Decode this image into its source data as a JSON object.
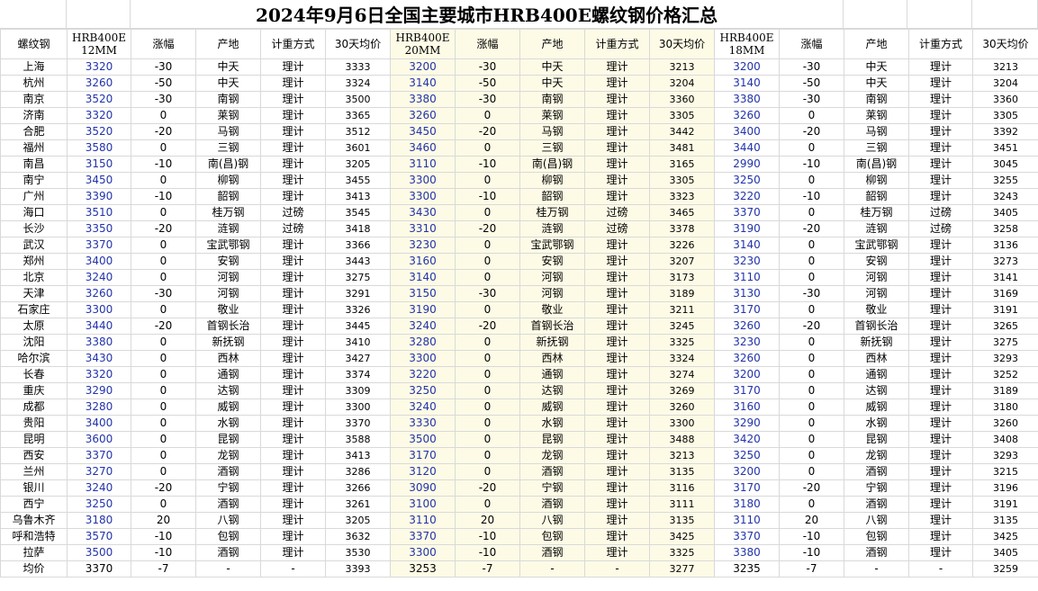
{
  "title": "2024年9月6日全国主要城市HRB400E螺纹钢价格汇总",
  "headers": {
    "city": "螺纹钢",
    "spec1_line1": "HRB400E",
    "spec1_line2": "12MM",
    "spec2_line1": "HRB400E",
    "spec2_line2": "20MM",
    "spec3_line1": "HRB400E",
    "spec3_line2": "18MM",
    "change": "涨幅",
    "origin": "产地",
    "method": "计重方式",
    "avg30": "30天均价"
  },
  "rows": [
    [
      "上海",
      "3320",
      "-30",
      "中天",
      "理计",
      "3333",
      "3200",
      "-30",
      "中天",
      "理计",
      "3213",
      "3200",
      "-30",
      "中天",
      "理计",
      "3213"
    ],
    [
      "杭州",
      "3260",
      "-50",
      "中天",
      "理计",
      "3324",
      "3140",
      "-50",
      "中天",
      "理计",
      "3204",
      "3140",
      "-50",
      "中天",
      "理计",
      "3204"
    ],
    [
      "南京",
      "3520",
      "-30",
      "南钢",
      "理计",
      "3500",
      "3380",
      "-30",
      "南钢",
      "理计",
      "3360",
      "3380",
      "-30",
      "南钢",
      "理计",
      "3360"
    ],
    [
      "济南",
      "3320",
      "0",
      "莱钢",
      "理计",
      "3365",
      "3260",
      "0",
      "莱钢",
      "理计",
      "3305",
      "3260",
      "0",
      "莱钢",
      "理计",
      "3305"
    ],
    [
      "合肥",
      "3520",
      "-20",
      "马钢",
      "理计",
      "3512",
      "3450",
      "-20",
      "马钢",
      "理计",
      "3442",
      "3400",
      "-20",
      "马钢",
      "理计",
      "3392"
    ],
    [
      "福州",
      "3580",
      "0",
      "三钢",
      "理计",
      "3601",
      "3460",
      "0",
      "三钢",
      "理计",
      "3481",
      "3440",
      "0",
      "三钢",
      "理计",
      "3451"
    ],
    [
      "南昌",
      "3150",
      "-10",
      "南(昌)钢",
      "理计",
      "3205",
      "3110",
      "-10",
      "南(昌)钢",
      "理计",
      "3165",
      "2990",
      "-10",
      "南(昌)钢",
      "理计",
      "3045"
    ],
    [
      "南宁",
      "3450",
      "0",
      "柳钢",
      "理计",
      "3455",
      "3300",
      "0",
      "柳钢",
      "理计",
      "3305",
      "3250",
      "0",
      "柳钢",
      "理计",
      "3255"
    ],
    [
      "广州",
      "3390",
      "-10",
      "韶钢",
      "理计",
      "3413",
      "3300",
      "-10",
      "韶钢",
      "理计",
      "3323",
      "3220",
      "-10",
      "韶钢",
      "理计",
      "3243"
    ],
    [
      "海口",
      "3510",
      "0",
      "桂万钢",
      "过磅",
      "3545",
      "3430",
      "0",
      "桂万钢",
      "过磅",
      "3465",
      "3370",
      "0",
      "桂万钢",
      "过磅",
      "3405"
    ],
    [
      "长沙",
      "3350",
      "-20",
      "涟钢",
      "过磅",
      "3418",
      "3310",
      "-20",
      "涟钢",
      "过磅",
      "3378",
      "3190",
      "-20",
      "涟钢",
      "过磅",
      "3258"
    ],
    [
      "武汉",
      "3370",
      "0",
      "宝武鄂钢",
      "理计",
      "3366",
      "3230",
      "0",
      "宝武鄂钢",
      "理计",
      "3226",
      "3140",
      "0",
      "宝武鄂钢",
      "理计",
      "3136"
    ],
    [
      "郑州",
      "3400",
      "0",
      "安钢",
      "理计",
      "3443",
      "3160",
      "0",
      "安钢",
      "理计",
      "3207",
      "3230",
      "0",
      "安钢",
      "理计",
      "3273"
    ],
    [
      "北京",
      "3240",
      "0",
      "河钢",
      "理计",
      "3275",
      "3140",
      "0",
      "河钢",
      "理计",
      "3173",
      "3110",
      "0",
      "河钢",
      "理计",
      "3141"
    ],
    [
      "天津",
      "3260",
      "-30",
      "河钢",
      "理计",
      "3291",
      "3150",
      "-30",
      "河钢",
      "理计",
      "3189",
      "3130",
      "-30",
      "河钢",
      "理计",
      "3169"
    ],
    [
      "石家庄",
      "3300",
      "0",
      "敬业",
      "理计",
      "3326",
      "3190",
      "0",
      "敬业",
      "理计",
      "3211",
      "3170",
      "0",
      "敬业",
      "理计",
      "3191"
    ],
    [
      "太原",
      "3440",
      "-20",
      "首钢长治",
      "理计",
      "3445",
      "3240",
      "-20",
      "首钢长治",
      "理计",
      "3245",
      "3260",
      "-20",
      "首钢长治",
      "理计",
      "3265"
    ],
    [
      "沈阳",
      "3380",
      "0",
      "新抚钢",
      "理计",
      "3410",
      "3280",
      "0",
      "新抚钢",
      "理计",
      "3325",
      "3230",
      "0",
      "新抚钢",
      "理计",
      "3275"
    ],
    [
      "哈尔滨",
      "3430",
      "0",
      "西林",
      "理计",
      "3427",
      "3300",
      "0",
      "西林",
      "理计",
      "3324",
      "3260",
      "0",
      "西林",
      "理计",
      "3293"
    ],
    [
      "长春",
      "3320",
      "0",
      "通钢",
      "理计",
      "3374",
      "3220",
      "0",
      "通钢",
      "理计",
      "3274",
      "3200",
      "0",
      "通钢",
      "理计",
      "3252"
    ],
    [
      "重庆",
      "3290",
      "0",
      "达钢",
      "理计",
      "3309",
      "3250",
      "0",
      "达钢",
      "理计",
      "3269",
      "3170",
      "0",
      "达钢",
      "理计",
      "3189"
    ],
    [
      "成都",
      "3280",
      "0",
      "威钢",
      "理计",
      "3300",
      "3240",
      "0",
      "威钢",
      "理计",
      "3260",
      "3160",
      "0",
      "威钢",
      "理计",
      "3180"
    ],
    [
      "贵阳",
      "3400",
      "0",
      "水钢",
      "理计",
      "3370",
      "3330",
      "0",
      "水钢",
      "理计",
      "3300",
      "3290",
      "0",
      "水钢",
      "理计",
      "3260"
    ],
    [
      "昆明",
      "3600",
      "0",
      "昆钢",
      "理计",
      "3588",
      "3500",
      "0",
      "昆钢",
      "理计",
      "3488",
      "3420",
      "0",
      "昆钢",
      "理计",
      "3408"
    ],
    [
      "西安",
      "3370",
      "0",
      "龙钢",
      "理计",
      "3413",
      "3170",
      "0",
      "龙钢",
      "理计",
      "3213",
      "3250",
      "0",
      "龙钢",
      "理计",
      "3293"
    ],
    [
      "兰州",
      "3270",
      "0",
      "酒钢",
      "理计",
      "3286",
      "3120",
      "0",
      "酒钢",
      "理计",
      "3135",
      "3200",
      "0",
      "酒钢",
      "理计",
      "3215"
    ],
    [
      "银川",
      "3240",
      "-20",
      "宁钢",
      "理计",
      "3266",
      "3090",
      "-20",
      "宁钢",
      "理计",
      "3116",
      "3170",
      "-20",
      "宁钢",
      "理计",
      "3196"
    ],
    [
      "西宁",
      "3250",
      "0",
      "酒钢",
      "理计",
      "3261",
      "3100",
      "0",
      "酒钢",
      "理计",
      "3111",
      "3180",
      "0",
      "酒钢",
      "理计",
      "3191"
    ],
    [
      "乌鲁木齐",
      "3180",
      "20",
      "八钢",
      "理计",
      "3205",
      "3110",
      "20",
      "八钢",
      "理计",
      "3135",
      "3110",
      "20",
      "八钢",
      "理计",
      "3135"
    ],
    [
      "呼和浩特",
      "3570",
      "-10",
      "包钢",
      "理计",
      "3632",
      "3370",
      "-10",
      "包钢",
      "理计",
      "3425",
      "3370",
      "-10",
      "包钢",
      "理计",
      "3425"
    ],
    [
      "拉萨",
      "3500",
      "-10",
      "酒钢",
      "理计",
      "3530",
      "3300",
      "-10",
      "酒钢",
      "理计",
      "3325",
      "3380",
      "-10",
      "酒钢",
      "理计",
      "3405"
    ]
  ],
  "average": [
    "均价",
    "3370",
    "-7",
    "-",
    "-",
    "3393",
    "3253",
    "-7",
    "-",
    "-",
    "3277",
    "3235",
    "-7",
    "-",
    "-",
    "3259"
  ]
}
